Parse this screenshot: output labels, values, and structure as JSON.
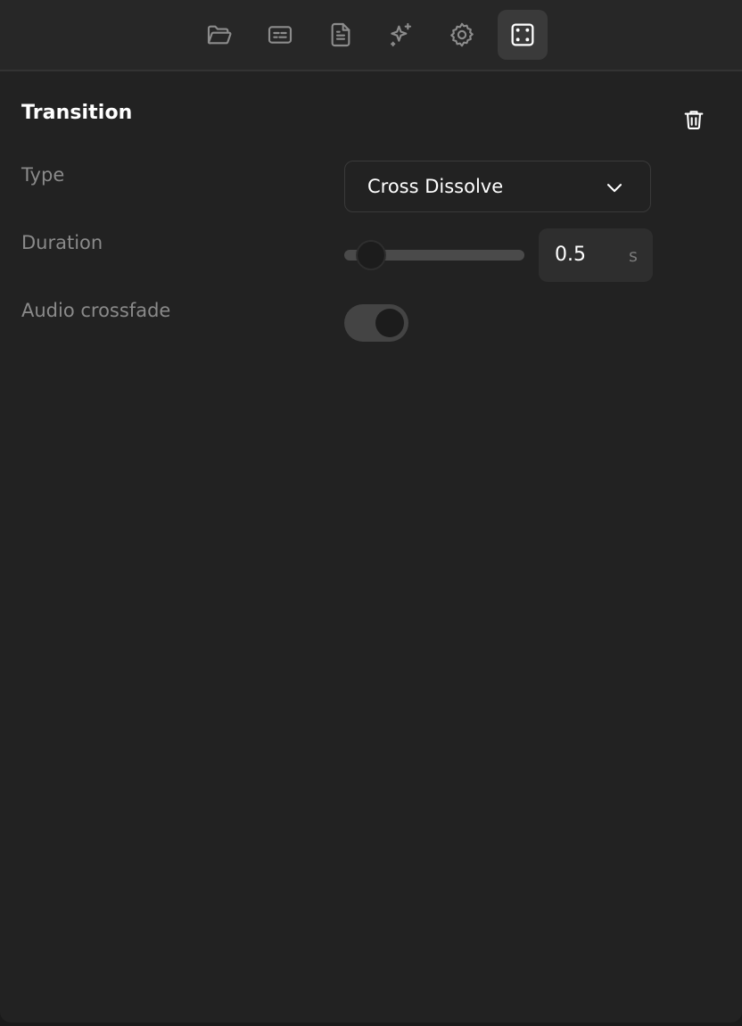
{
  "toolbar": {
    "items": [
      {
        "icon": "folder-open-icon",
        "active": false
      },
      {
        "icon": "captions-icon",
        "active": false
      },
      {
        "icon": "document-icon",
        "active": false
      },
      {
        "icon": "sparkles-icon",
        "active": false
      },
      {
        "icon": "gear-icon",
        "active": false
      },
      {
        "icon": "transition-frame-icon",
        "active": true
      }
    ]
  },
  "section": {
    "title": "Transition",
    "delete_icon": "trash-icon"
  },
  "fields": {
    "type": {
      "label": "Type",
      "value": "Cross Dissolve",
      "icon": "chevron-down-icon"
    },
    "duration": {
      "label": "Duration",
      "value": "0.5",
      "unit": "s",
      "slider_fraction": 0.15
    },
    "audio_crossfade": {
      "label": "Audio crossfade",
      "enabled": true
    }
  },
  "colors": {
    "panel_background": "#222222",
    "toolbar_background": "#272727",
    "active_tab": "#3a3a3a",
    "label_text": "#8a8a8a",
    "primary_text": "#ffffff",
    "icon_inactive": "#8c8c8c",
    "icon_active": "#ffffff"
  }
}
